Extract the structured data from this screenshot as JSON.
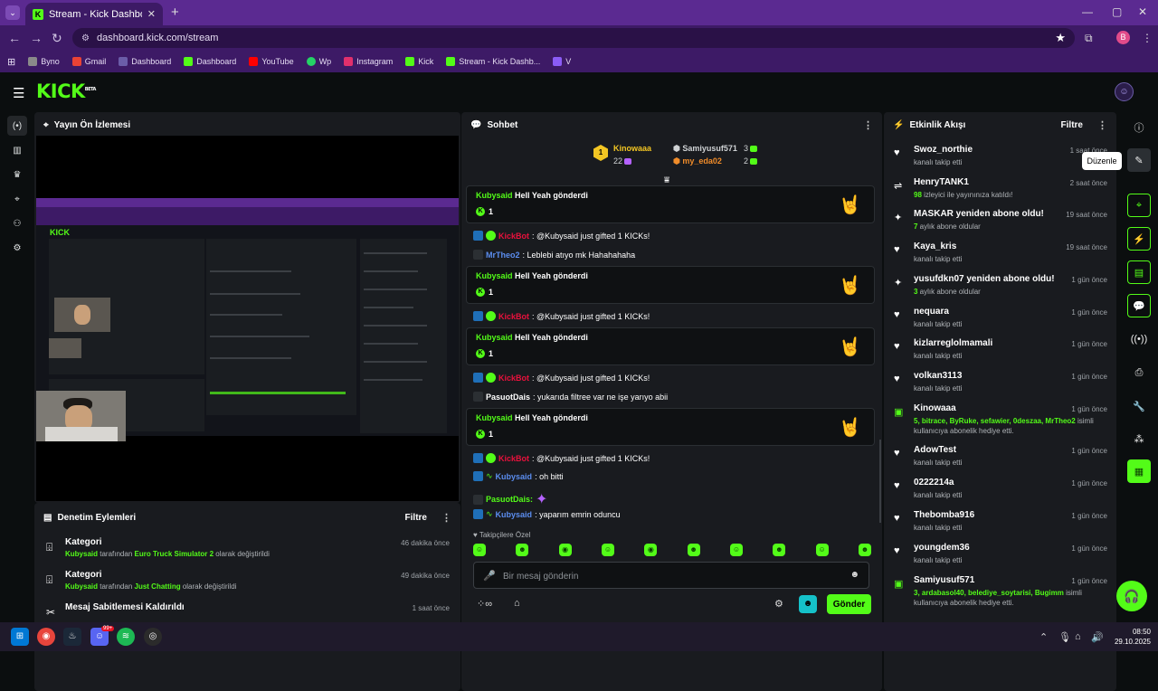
{
  "browser": {
    "tab_title": "Stream - Kick Dashboard",
    "url": "dashboard.kick.com/stream",
    "profile_initial": "B",
    "bookmarks": [
      {
        "label": "Byno",
        "color": "#8a8a8a"
      },
      {
        "label": "Gmail",
        "color": "#ea4335"
      },
      {
        "label": "Dashboard",
        "color": "#6b5da8"
      },
      {
        "label": "Dashboard",
        "color": "#53fc18"
      },
      {
        "label": "YouTube",
        "color": "#ff0000"
      },
      {
        "label": "Wp",
        "color": "#25d366"
      },
      {
        "label": "Instagram",
        "color": "#e1306c"
      },
      {
        "label": "Kick",
        "color": "#53fc18"
      },
      {
        "label": "Stream - Kick Dashb...",
        "color": "#53fc18"
      },
      {
        "label": "V",
        "color": "#5b2a91"
      }
    ]
  },
  "app": {
    "logo": "KICK",
    "logo_badge": "BETA",
    "colors": {
      "accent": "#53fc18",
      "panel": "#191b1f",
      "bg": "#0b0e0f"
    }
  },
  "preview": {
    "title": "Yayın Ön İzlemesi",
    "nested_logo": "KICK"
  },
  "moderation": {
    "title": "Denetim Eylemleri",
    "filter": "Filtre",
    "rows": [
      {
        "title": "Kategori",
        "user": "Kubysaid",
        "mid": " tarafından ",
        "target": "Euro Truck Simulator 2",
        "tail": " olarak değiştirildi",
        "time": "46 dakika önce"
      },
      {
        "title": "Kategori",
        "user": "Kubysaid",
        "mid": " tarafından ",
        "target": "Just Chatting",
        "tail": " olarak değiştirildi",
        "time": "49 dakika önce"
      },
      {
        "title": "Mesaj Sabitlemesi Kaldırıldı",
        "user": "",
        "mid": "",
        "target": "",
        "tail": "",
        "time": "1 saat önce"
      }
    ]
  },
  "chat": {
    "title": "Sohbet",
    "leaders": [
      {
        "rank": "1",
        "name": "Kinowaaa",
        "count": "22"
      },
      {
        "name": "Samiyusuf571",
        "count": "3"
      },
      {
        "name": "my_eda02",
        "count": "2"
      }
    ],
    "gift_text": " gönderdi",
    "gift_user": "Kubysaid",
    "gift_item": "Hell Yeah",
    "gift_count": "1",
    "bot_name": "KickBot",
    "bot_msg": ": @Kubysaid just gifted 1 KICKs!",
    "messages": {
      "m1_user": "MrTheo2",
      "m1_text": ": Leblebi atıyo mk Hahahahaha",
      "m2_user": "PasuotDais",
      "m2_text": ": yukarıda filtree var ne işe yarıyo abii",
      "m3_user": "Kubysaid",
      "m3_text": ": oh bitti",
      "m4_user": "PasuotDais:",
      "m5_user": "Kubysaid",
      "m5_text": ": yaparım emrin oduncu"
    },
    "emotes_label": "Takipçilere Özel",
    "input_placeholder": "Bir mesaj gönderin",
    "send_label": "Gönder"
  },
  "activity": {
    "title": "Etkinlik Akışı",
    "filter": "Filtre",
    "tooltip": "Düzenle",
    "items": [
      {
        "icon": "heart-icon",
        "name": "Swoz_northie",
        "desc": "kanalı takip etti",
        "desc_green": "",
        "time": "1 saat önce"
      },
      {
        "icon": "raid-icon",
        "name": "HenryTANK1",
        "desc_green": "98",
        "desc": " izleyici ile yayınınıza katıldı!",
        "time": "2 saat önce"
      },
      {
        "icon": "sparkle-icon",
        "name": "MASKAR yeniden abone oldu!",
        "desc_green": "7",
        "desc": " aylık abone oldular",
        "time": "19 saat önce"
      },
      {
        "icon": "heart-icon",
        "name": "Kaya_kris",
        "desc_green": "",
        "desc": "kanalı takip etti",
        "time": "19 saat önce"
      },
      {
        "icon": "sparkle-icon",
        "name": "yusufdkn07 yeniden abone oldu!",
        "desc_green": "3",
        "desc": " aylık abone oldular",
        "time": "1 gün önce"
      },
      {
        "icon": "heart-icon",
        "name": "nequara",
        "desc_green": "",
        "desc": "kanalı takip etti",
        "time": "1 gün önce"
      },
      {
        "icon": "heart-icon",
        "name": "kizlarreglolmamali",
        "desc_green": "",
        "desc": "kanalı takip etti",
        "time": "1 gün önce"
      },
      {
        "icon": "heart-icon",
        "name": "volkan3113",
        "desc_green": "",
        "desc": "kanalı takip etti",
        "time": "1 gün önce"
      },
      {
        "icon": "gift-icon",
        "name": "Kinowaaa",
        "desc_green": "5, bitrace, ByRuke, sefawier, 0deszaa, MrTheo2",
        "desc": " isimli kullanıcıya abonelik hediye etti.",
        "time": "1 gün önce"
      },
      {
        "icon": "heart-icon",
        "name": "AdowTest",
        "desc_green": "",
        "desc": "kanalı takip etti",
        "time": "1 gün önce"
      },
      {
        "icon": "heart-icon",
        "name": "0222214a",
        "desc_green": "",
        "desc": "kanalı takip etti",
        "time": "1 gün önce"
      },
      {
        "icon": "heart-icon",
        "name": "Thebomba916",
        "desc_green": "",
        "desc": "kanalı takip etti",
        "time": "1 gün önce"
      },
      {
        "icon": "heart-icon",
        "name": "youngdem36",
        "desc_green": "",
        "desc": "kanalı takip etti",
        "time": "1 gün önce"
      },
      {
        "icon": "gift-icon",
        "name": "Samiyusuf571",
        "desc_green": "3, ardabasol40, belediye_soytarisi, Bugimm",
        "desc": " isimli kullanıcıya abonelik hediye etti.",
        "time": "1 gün önce"
      }
    ]
  },
  "taskbar": {
    "time": "08:50",
    "date": "29.10.2025",
    "discord_badge": "99+"
  }
}
